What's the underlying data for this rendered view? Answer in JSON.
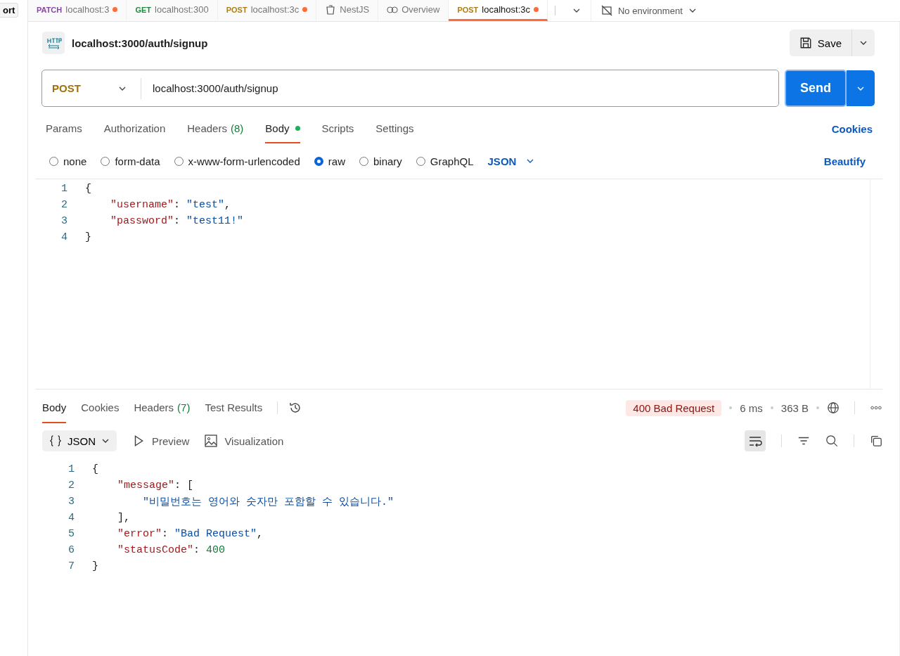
{
  "sidebar": {
    "button": "ort"
  },
  "tabs": [
    {
      "kind": "request",
      "method": "PATCH",
      "color": "#8e44ad",
      "label": "localhost:3",
      "unsaved": true,
      "selected": false
    },
    {
      "kind": "request",
      "method": "GET",
      "color": "#1e8a3e",
      "label": "localhost:300",
      "unsaved": false,
      "selected": false
    },
    {
      "kind": "request",
      "method": "POST",
      "color": "#b07d12",
      "label": "localhost:3c",
      "unsaved": true,
      "selected": false
    },
    {
      "kind": "collection",
      "label": "NestJS",
      "selected": false
    },
    {
      "kind": "overview",
      "label": "Overview",
      "selected": false
    },
    {
      "kind": "request",
      "method": "POST",
      "color": "#b07d12",
      "label": "localhost:3c",
      "unsaved": true,
      "selected": true
    }
  ],
  "environment": "No environment",
  "request": {
    "title": "localhost:3000/auth/signup",
    "save": "Save",
    "method": "POST",
    "url": "localhost:3000/auth/signup",
    "send": "Send"
  },
  "request_tabs": [
    {
      "label": "Params",
      "selected": false,
      "dot": false
    },
    {
      "label": "Authorization",
      "selected": false,
      "dot": false
    },
    {
      "label": "Headers",
      "count": "(8)",
      "selected": false,
      "dot": false
    },
    {
      "label": "Body",
      "selected": true,
      "dot": true
    },
    {
      "label": "Scripts",
      "selected": false,
      "dot": false
    },
    {
      "label": "Settings",
      "selected": false,
      "dot": false
    }
  ],
  "cookies_link": "Cookies",
  "body_types": [
    {
      "label": "none",
      "selected": false
    },
    {
      "label": "form-data",
      "selected": false
    },
    {
      "label": "x-www-form-urlencoded",
      "selected": false
    },
    {
      "label": "raw",
      "selected": true
    },
    {
      "label": "binary",
      "selected": false
    },
    {
      "label": "GraphQL",
      "selected": false
    }
  ],
  "body_language": "JSON",
  "beautify": "Beautify",
  "request_body": [
    {
      "n": "1",
      "tokens": [
        {
          "kind": "punct",
          "text": "{"
        }
      ]
    },
    {
      "n": "2",
      "tokens": [
        {
          "kind": "key",
          "text": "    \"username\""
        },
        {
          "kind": "punct",
          "text": ": "
        },
        {
          "kind": "string",
          "text": "\"test\""
        },
        {
          "kind": "punct",
          "text": ","
        }
      ]
    },
    {
      "n": "3",
      "tokens": [
        {
          "kind": "key",
          "text": "    \"password\""
        },
        {
          "kind": "punct",
          "text": ": "
        },
        {
          "kind": "string",
          "text": "\"test11!\""
        }
      ]
    },
    {
      "n": "4",
      "tokens": [
        {
          "kind": "punct",
          "text": "}"
        }
      ]
    }
  ],
  "response_tabs": [
    {
      "label": "Body",
      "selected": true
    },
    {
      "label": "Cookies",
      "selected": false
    },
    {
      "label": "Headers",
      "count": "(7)",
      "selected": false
    },
    {
      "label": "Test Results",
      "selected": false
    }
  ],
  "status": {
    "code": "400 Bad Request",
    "time": "6 ms",
    "size": "363 B"
  },
  "views": {
    "format": "JSON",
    "preview": "Preview",
    "visualization": "Visualization"
  },
  "response_body": [
    {
      "n": "1",
      "tokens": [
        {
          "kind": "punct",
          "text": "{"
        }
      ]
    },
    {
      "n": "2",
      "tokens": [
        {
          "kind": "key",
          "text": "    \"message\""
        },
        {
          "kind": "punct",
          "text": ": ["
        }
      ]
    },
    {
      "n": "3",
      "tokens": [
        {
          "kind": "string",
          "text": "        \"비밀번호는 영어와 숫자만 포함할 수 있습니다.\""
        }
      ]
    },
    {
      "n": "4",
      "tokens": [
        {
          "kind": "punct",
          "text": "    ],"
        }
      ]
    },
    {
      "n": "5",
      "tokens": [
        {
          "kind": "key",
          "text": "    \"error\""
        },
        {
          "kind": "punct",
          "text": ": "
        },
        {
          "kind": "string",
          "text": "\"Bad Request\""
        },
        {
          "kind": "punct",
          "text": ","
        }
      ]
    },
    {
      "n": "6",
      "tokens": [
        {
          "kind": "key",
          "text": "    \"statusCode\""
        },
        {
          "kind": "punct",
          "text": ": "
        },
        {
          "kind": "number",
          "text": "400"
        }
      ]
    },
    {
      "n": "7",
      "tokens": [
        {
          "kind": "punct",
          "text": "}"
        }
      ]
    }
  ]
}
